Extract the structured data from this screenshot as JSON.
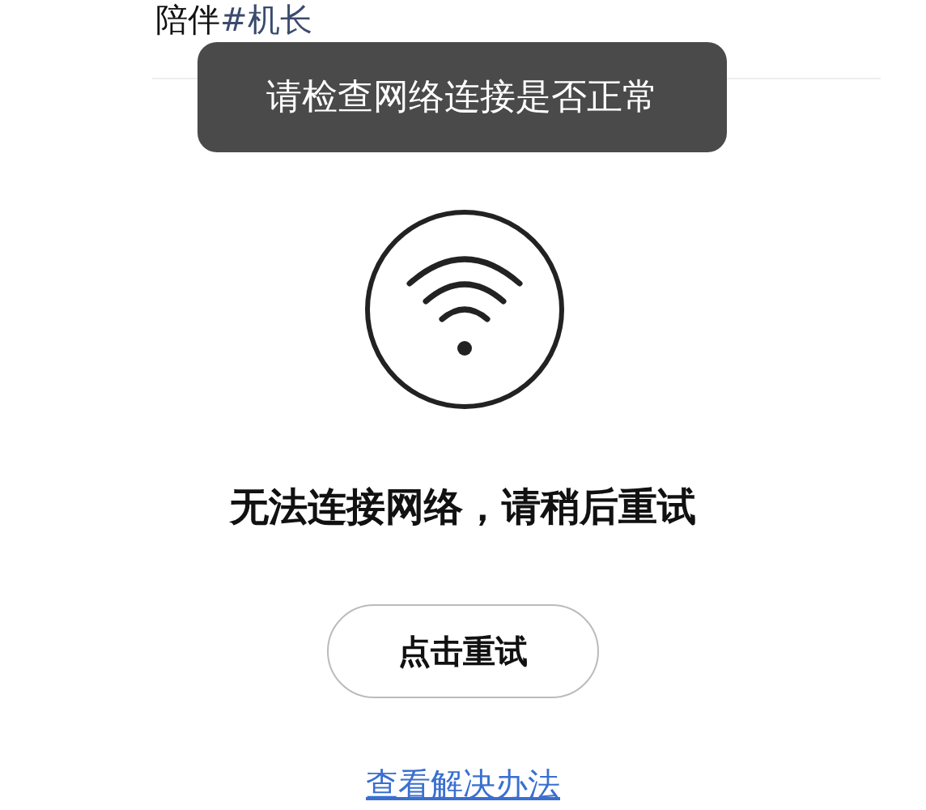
{
  "header": {
    "text": "陪伴",
    "tag": "#机长"
  },
  "toast": {
    "message": "请检查网络连接是否正常"
  },
  "error": {
    "title": "无法连接网络，请稍后重试",
    "retry_button": "点击重试",
    "help_link": "查看解决办法"
  }
}
